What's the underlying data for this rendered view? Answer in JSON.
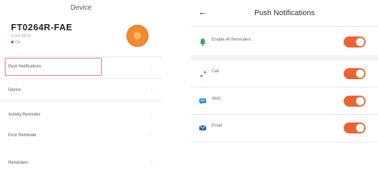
{
  "left": {
    "title": "Device",
    "device_name": "FT0264R-FAE",
    "device_subtitle": "1234-5678",
    "device_status": "On",
    "menu": [
      {
        "label": "Push Notifications"
      },
      {
        "label": "Device",
        "value": "..."
      },
      {
        "label": "Activity Reminder"
      },
      {
        "label": "Error Reminder",
        "subtitle": "..."
      },
      {
        "label": "Reminders"
      }
    ]
  },
  "right": {
    "title": "Push Notifications",
    "back_icon": "back-arrow-icon",
    "rows": [
      {
        "label": "Enable All Reminders",
        "icon": "bell-icon",
        "enabled": true
      },
      {
        "label": "Call",
        "icon": "phone-icon",
        "enabled": true
      },
      {
        "label": "SMS",
        "icon": "message-icon",
        "enabled": true
      },
      {
        "label": "Email",
        "icon": "email-icon",
        "enabled": true
      }
    ]
  },
  "colors": {
    "accent": "#ec6331",
    "highlight_border": "#e0758a",
    "status_green": "#3aa957"
  }
}
